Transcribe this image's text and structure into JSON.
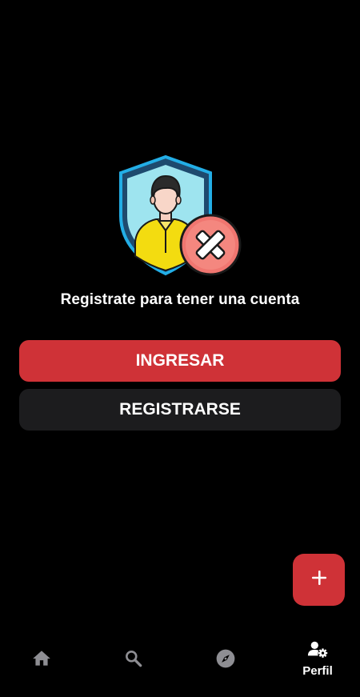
{
  "main": {
    "headline": "Registrate para tener una cuenta",
    "login_label": "INGRESAR",
    "register_label": "REGISTRARSE",
    "illustration_icon": "user-shield-denied-icon"
  },
  "fab": {
    "icon": "plus-icon"
  },
  "tabbar": {
    "items": [
      {
        "icon": "home-icon",
        "label": ""
      },
      {
        "icon": "search-icon",
        "label": ""
      },
      {
        "icon": "compass-icon",
        "label": ""
      },
      {
        "icon": "user-gear-icon",
        "label": "Perfil"
      }
    ],
    "active_index": 3
  },
  "colors": {
    "background": "#000000",
    "accent": "#cf3237",
    "secondary_button": "#1c1c1e",
    "inactive_icon": "#8e8e93",
    "active_icon": "#ffffff"
  }
}
